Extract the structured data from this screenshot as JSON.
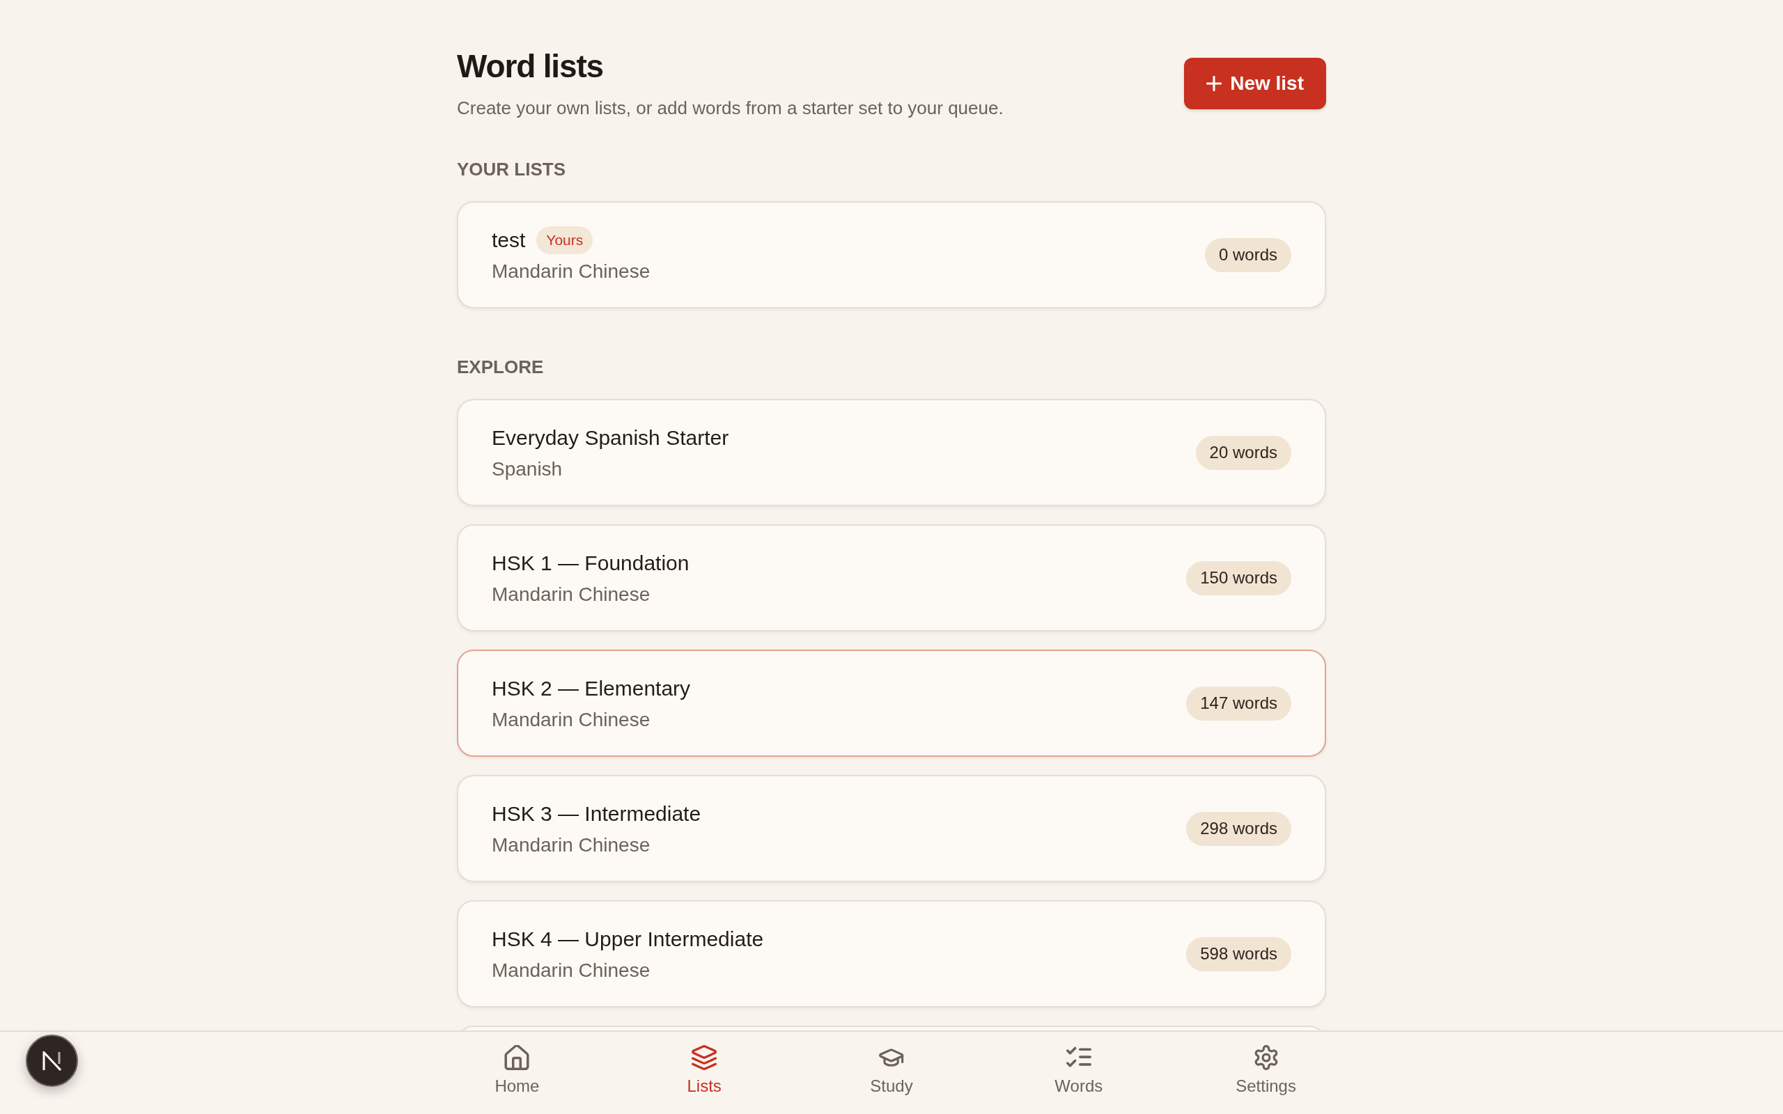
{
  "header": {
    "title": "Word lists",
    "subtitle": "Create your own lists, or add words from a starter set to your queue.",
    "new_list_button": "New list"
  },
  "sections": [
    {
      "heading": "YOUR LISTS",
      "lists": [
        {
          "name": "test",
          "badge": "Yours",
          "language": "Mandarin Chinese",
          "count": "0 words",
          "selected": false
        }
      ]
    },
    {
      "heading": "EXPLORE",
      "lists": [
        {
          "name": "Everyday Spanish Starter",
          "language": "Spanish",
          "count": "20 words",
          "selected": false
        },
        {
          "name": "HSK 1 — Foundation",
          "language": "Mandarin Chinese",
          "count": "150 words",
          "selected": false
        },
        {
          "name": "HSK 2 — Elementary",
          "language": "Mandarin Chinese",
          "count": "147 words",
          "selected": true
        },
        {
          "name": "HSK 3 — Intermediate",
          "language": "Mandarin Chinese",
          "count": "298 words",
          "selected": false
        },
        {
          "name": "HSK 4 — Upper Intermediate",
          "language": "Mandarin Chinese",
          "count": "598 words",
          "selected": false
        }
      ]
    }
  ],
  "bottom_nav": [
    {
      "label": "Home",
      "selected": false
    },
    {
      "label": "Lists",
      "selected": true
    },
    {
      "label": "Study",
      "selected": false
    },
    {
      "label": "Words",
      "selected": false
    },
    {
      "label": "Settings",
      "selected": false
    }
  ]
}
